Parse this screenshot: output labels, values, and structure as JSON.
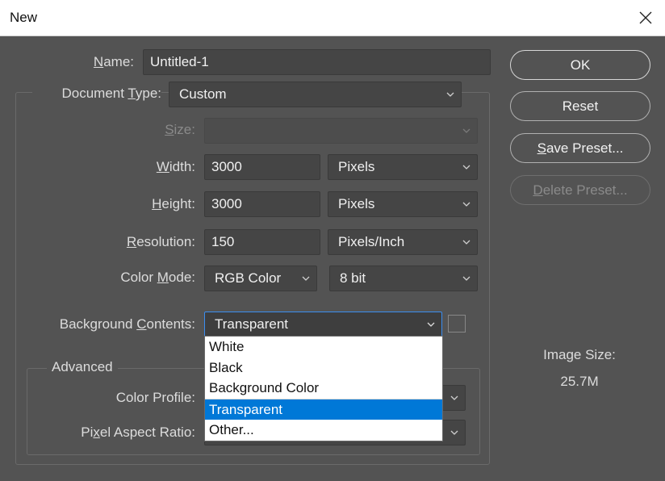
{
  "window": {
    "title": "New"
  },
  "form": {
    "name_label_pre": "",
    "name_label_u": "N",
    "name_label_post": "ame:",
    "name_value": "Untitled-1",
    "doctype_label_pre": "Document ",
    "doctype_label_u": "T",
    "doctype_label_post": "ype:",
    "doctype_value": "Custom",
    "size_label_pre": "",
    "size_label_u": "S",
    "size_label_post": "ize:",
    "size_value": "",
    "width_label_pre": "",
    "width_label_u": "W",
    "width_label_post": "idth:",
    "width_value": "3000",
    "width_unit": "Pixels",
    "height_label_pre": "",
    "height_label_u": "H",
    "height_label_post": "eight:",
    "height_value": "3000",
    "height_unit": "Pixels",
    "resolution_label_pre": "",
    "resolution_label_u": "R",
    "resolution_label_post": "esolution:",
    "resolution_value": "150",
    "resolution_unit": "Pixels/Inch",
    "colormode_label_pre": "Color ",
    "colormode_label_u": "M",
    "colormode_label_post": "ode:",
    "colormode_value": "RGB Color",
    "bitdepth_value": "8 bit",
    "bg_label_pre": "Background ",
    "bg_label_u": "C",
    "bg_label_post": "ontents:",
    "bg_value": "Transparent"
  },
  "advanced": {
    "title": "Advanced",
    "color_profile_label": "Color Profile:",
    "pixel_aspect_label_pre": "Pi",
    "pixel_aspect_label_u": "x",
    "pixel_aspect_label_post": "el Aspect Ratio:"
  },
  "dropdown": {
    "options": [
      "White",
      "Black",
      "Background Color",
      "Transparent",
      "Other..."
    ],
    "selected": "Transparent"
  },
  "buttons": {
    "ok": "OK",
    "reset": "Reset",
    "save_preset_pre": "",
    "save_preset_u": "S",
    "save_preset_post": "ave Preset...",
    "delete_preset_pre": "",
    "delete_preset_u": "D",
    "delete_preset_post": "elete Preset..."
  },
  "info": {
    "image_size_label": "Image Size:",
    "image_size_value": "25.7M"
  },
  "colors": {
    "dialog_bg": "#535353",
    "field_bg": "#454545",
    "accent": "#0078d7",
    "focus_border": "#3b8ef0"
  }
}
